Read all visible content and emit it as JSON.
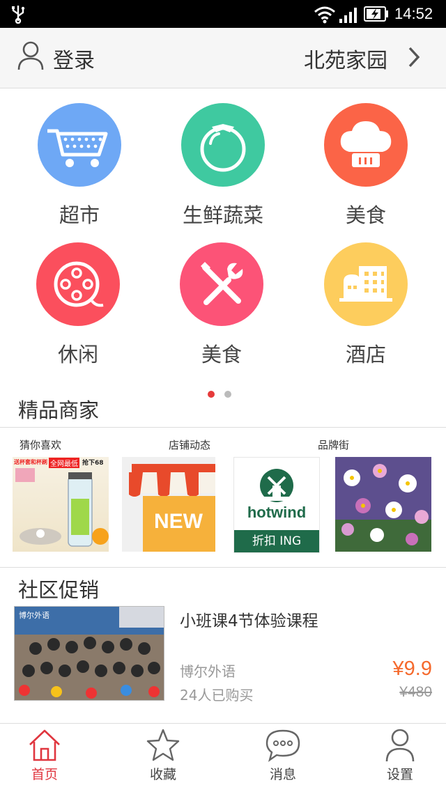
{
  "status_bar": {
    "time": "14:52"
  },
  "header": {
    "login_label": "登录",
    "community_name": "北苑家园"
  },
  "categories": [
    {
      "label": "超市",
      "color": "#6ea8f5",
      "icon": "cart-icon"
    },
    {
      "label": "生鲜蔬菜",
      "color": "#3fc9a0",
      "icon": "tomato-icon"
    },
    {
      "label": "美食",
      "color": "#fb6447",
      "icon": "chef-hat-icon"
    },
    {
      "label": "休闲",
      "color": "#fb4f5d",
      "icon": "film-reel-icon"
    },
    {
      "label": "美食",
      "color": "#fc5377",
      "icon": "tools-icon"
    },
    {
      "label": "酒店",
      "color": "#fdcd5d",
      "icon": "buildings-icon"
    }
  ],
  "pagination": {
    "active_color": "#e63b3b",
    "inactive_color": "#bbbbbb"
  },
  "featured": {
    "title": "精品商家",
    "sublabels": [
      "猜你喜欢",
      "店铺动态",
      "品牌街"
    ],
    "thumb1_text": [
      "送杯套和杯刷",
      "全网最低",
      "抢下68"
    ],
    "thumb2_text": "NEW",
    "thumb3_brand": "hotwind",
    "thumb3_tag": "折扣 ING"
  },
  "promotion": {
    "section_title": "社区促销",
    "image_caption": "博尔外语",
    "title": "小班课4节体验课程",
    "merchant": "博尔外语",
    "sold": "24人已购买",
    "price": "¥9.9",
    "original_price": "¥480"
  },
  "tabbar": [
    {
      "label": "首页",
      "icon": "home-icon",
      "active": true
    },
    {
      "label": "收藏",
      "icon": "star-icon",
      "active": false
    },
    {
      "label": "消息",
      "icon": "chat-icon",
      "active": false
    },
    {
      "label": "设置",
      "icon": "user-icon",
      "active": false
    }
  ],
  "colors": {
    "accent": "#e0363f",
    "price": "#f56a2d",
    "tab_inactive": "#666666"
  }
}
